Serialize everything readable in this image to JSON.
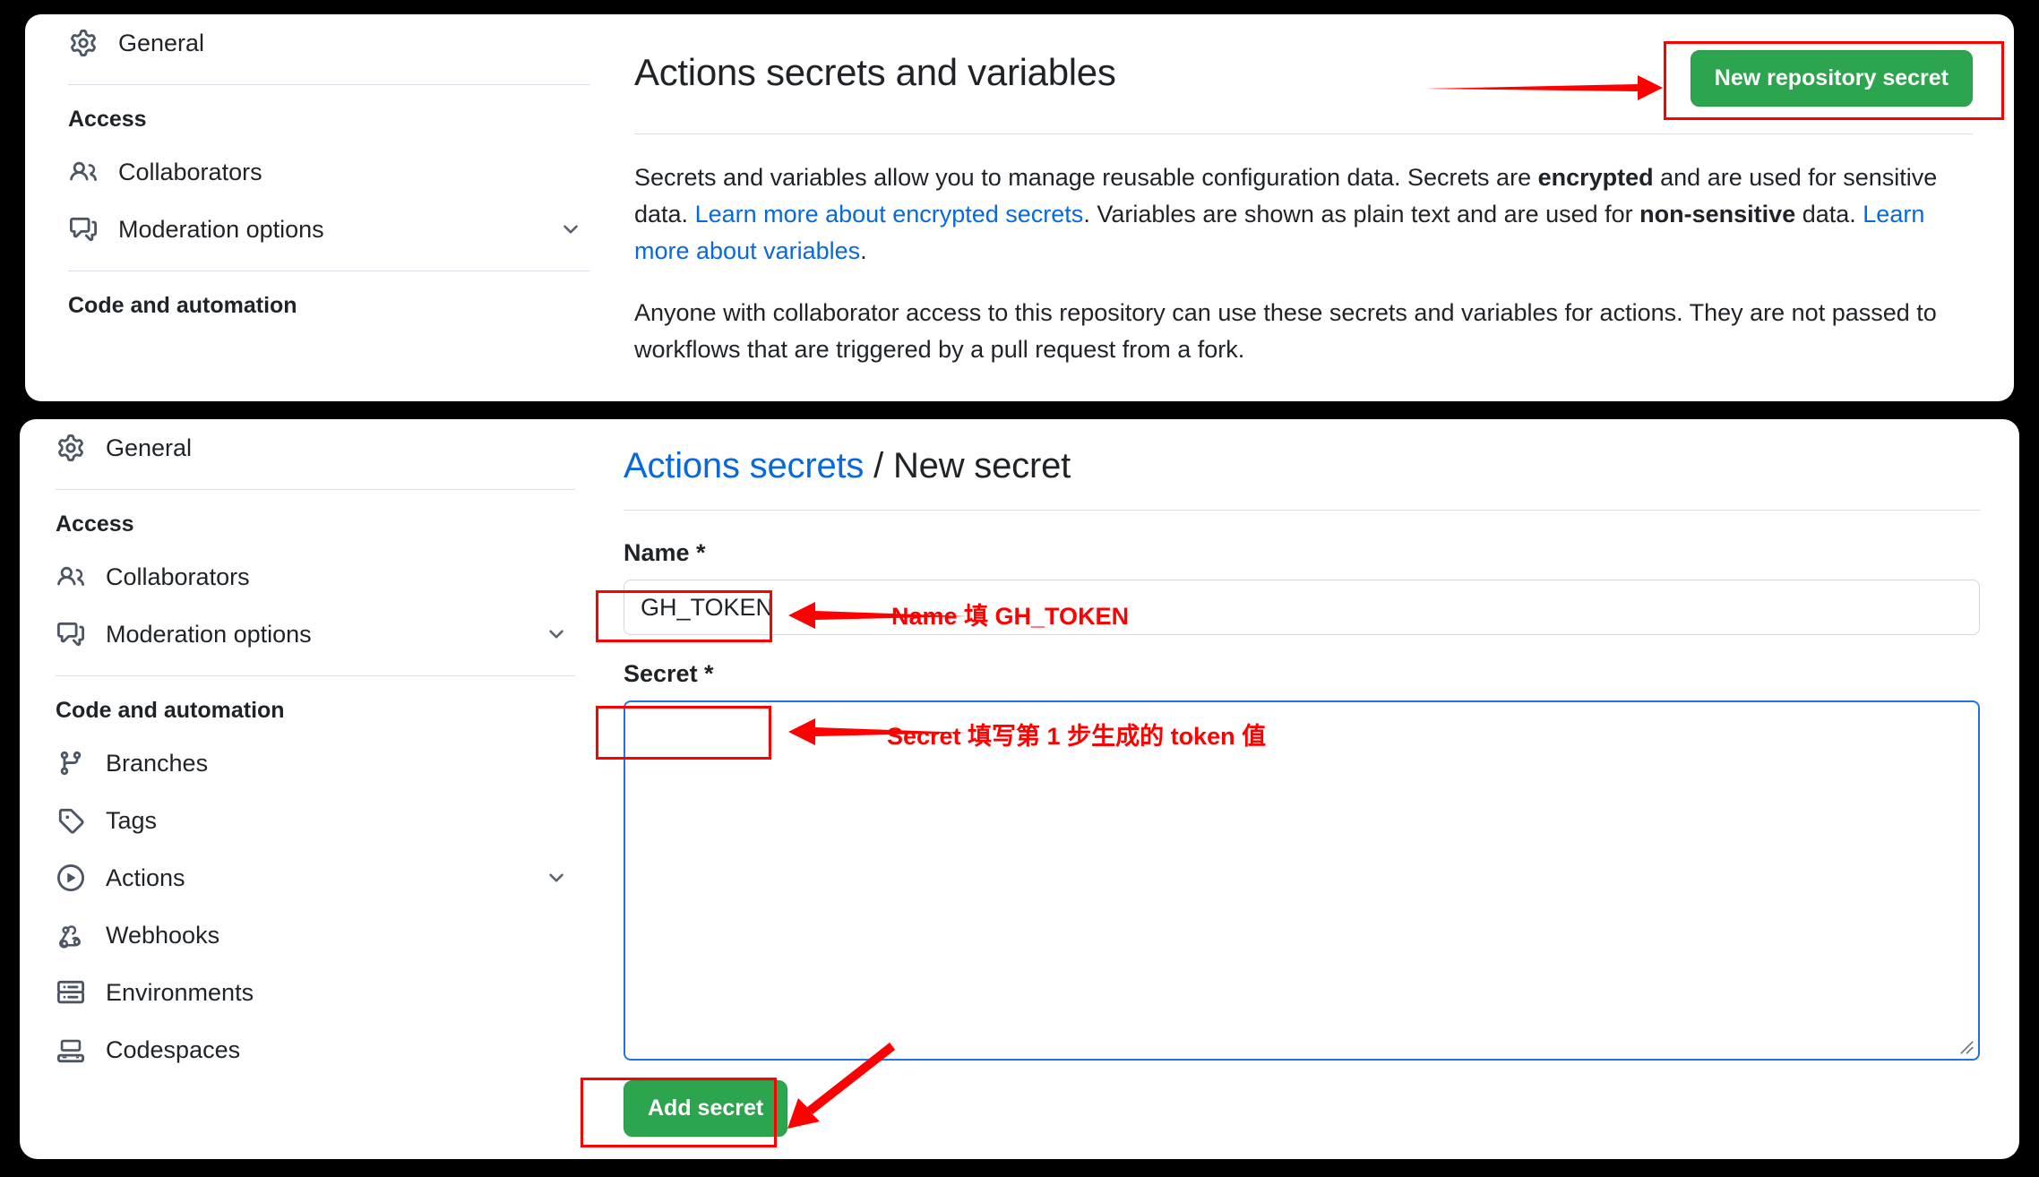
{
  "top_panel": {
    "sidebar": {
      "primary": [
        {
          "label": "General",
          "icon": "gear-icon",
          "chevron": false
        }
      ],
      "sections": [
        {
          "title": "Access",
          "items": [
            {
              "label": "Collaborators",
              "icon": "people-icon",
              "chevron": false
            },
            {
              "label": "Moderation options",
              "icon": "comment-discussion-icon",
              "chevron": true
            }
          ]
        },
        {
          "title": "Code and automation",
          "items": []
        }
      ]
    },
    "header": {
      "title": "Actions secrets and variables",
      "new_secret_button": "New repository secret"
    },
    "paragraphs": {
      "p1_a": "Secrets and variables allow you to manage reusable configuration data. Secrets are ",
      "p1_bold1": "encrypted",
      "p1_b": " and are used for sensitive data. ",
      "p1_link1": "Learn more about encrypted secrets",
      "p1_c": ". Variables are shown as plain text and are used for ",
      "p1_bold2": "non-sensitive",
      "p1_d": " data. ",
      "p1_link2": "Learn more about variables",
      "p1_e": ".",
      "p2": "Anyone with collaborator access to this repository can use these secrets and variables for actions. They are not passed to workflows that are triggered by a pull request from a fork."
    }
  },
  "bottom_panel": {
    "sidebar": {
      "primary": [
        {
          "label": "General",
          "icon": "gear-icon",
          "chevron": false
        }
      ],
      "sections": [
        {
          "title": "Access",
          "items": [
            {
              "label": "Collaborators",
              "icon": "people-icon",
              "chevron": false
            },
            {
              "label": "Moderation options",
              "icon": "comment-discussion-icon",
              "chevron": true
            }
          ]
        },
        {
          "title": "Code and automation",
          "items": [
            {
              "label": "Branches",
              "icon": "git-branch-icon",
              "chevron": false
            },
            {
              "label": "Tags",
              "icon": "tag-icon",
              "chevron": false
            },
            {
              "label": "Actions",
              "icon": "play-circle-icon",
              "chevron": true
            },
            {
              "label": "Webhooks",
              "icon": "webhook-icon",
              "chevron": false
            },
            {
              "label": "Environments",
              "icon": "server-icon",
              "chevron": false
            },
            {
              "label": "Codespaces",
              "icon": "codespaces-icon",
              "chevron": false
            }
          ]
        }
      ]
    },
    "breadcrumb": {
      "parent": "Actions secrets",
      "separator": "/",
      "current": "New secret"
    },
    "form": {
      "name_label": "Name *",
      "name_value": "GH_TOKEN",
      "name_placeholder": "",
      "secret_label": "Secret *",
      "secret_value": "",
      "secret_placeholder": "",
      "submit_label": "Add secret"
    }
  },
  "annotations": {
    "new_secret_note": "",
    "name_note": "Name 填 GH_TOKEN",
    "secret_note": "Secret 填写第 1 步生成的 token 值",
    "colors": {
      "highlight": "#ff0000",
      "accent_green": "#2da44e",
      "link_blue": "#0969da",
      "focus_blue": "#2272e4"
    }
  }
}
